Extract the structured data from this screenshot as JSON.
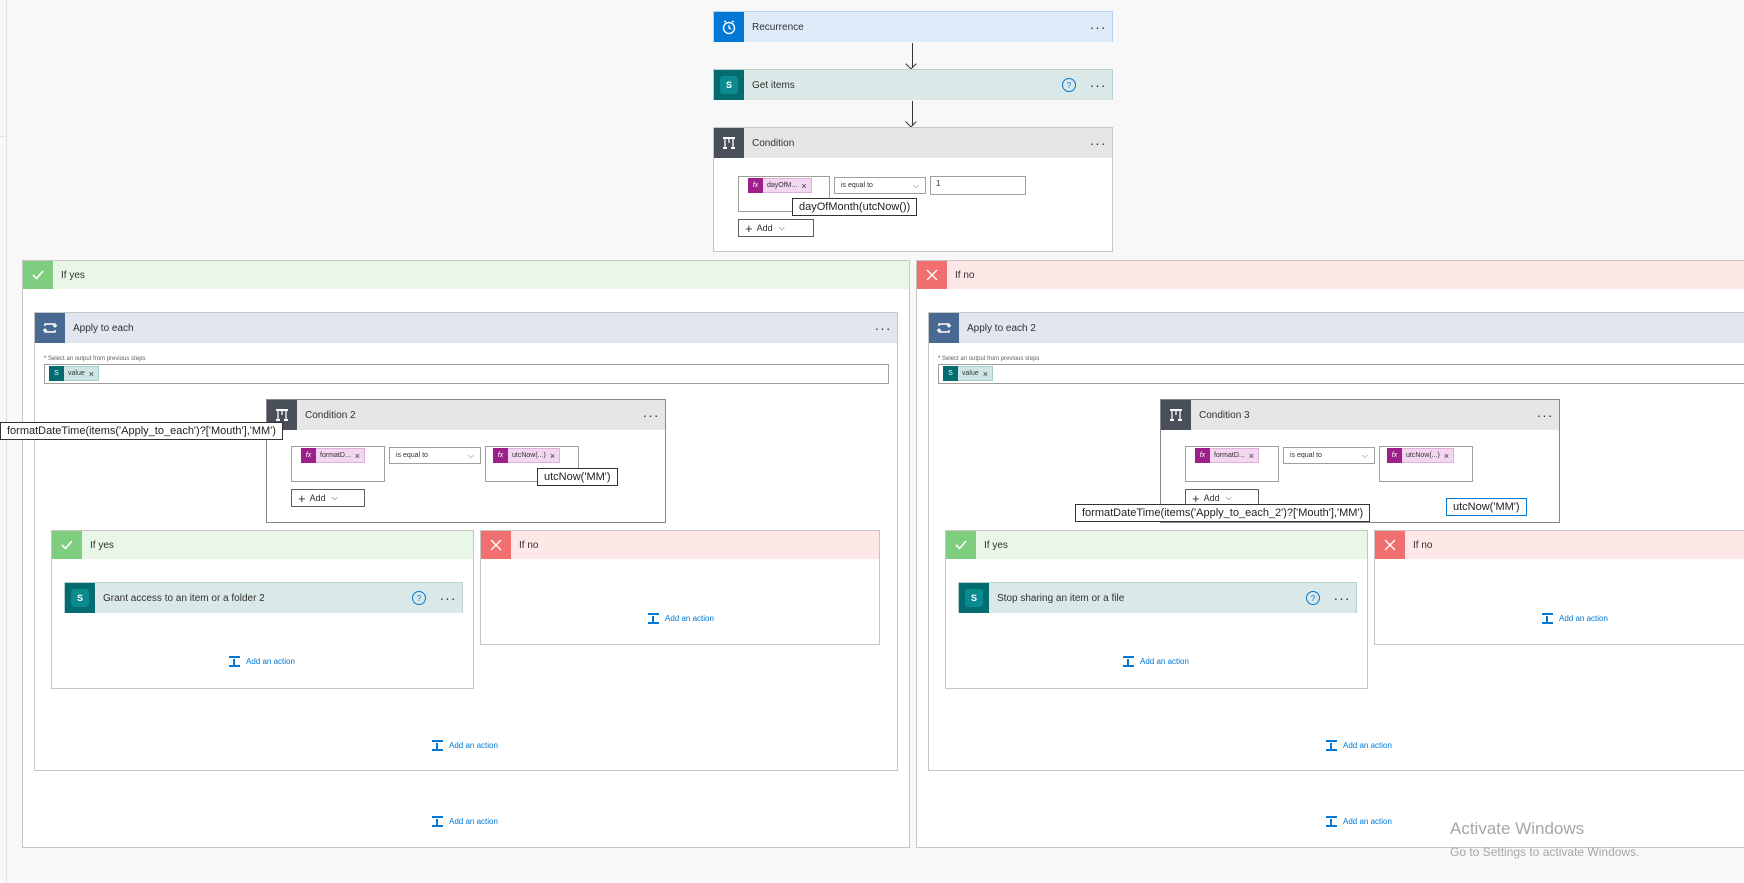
{
  "flow": {
    "recurrence": {
      "title": "Recurrence",
      "color": "#0078d4",
      "icon": "clock-icon"
    },
    "get_items": {
      "title": "Get items",
      "color": "#036c70",
      "icon": "sharepoint-icon"
    },
    "condition": {
      "title": "Condition",
      "token_text": "dayOfM...",
      "operator": "is equal to",
      "value": "1",
      "tooltip": "dayOfMonth(utcNow())",
      "add_label": "Add"
    }
  },
  "branch_yes": {
    "label": "If yes",
    "apply": {
      "title": "Apply to each",
      "select_label": "Select an output from previous steps",
      "token": "value",
      "condition": {
        "title": "Condition 2",
        "left_token": "formatD...",
        "operator": "is equal to",
        "right_token": "utcNow(...)",
        "tooltip_left": "formatDateTime(items('Apply_to_each')?['Mouth'],'MM')",
        "tooltip_right": "utcNow('MM')",
        "add_label": "Add"
      },
      "yes": {
        "label": "If yes",
        "action": "Grant access to an item or a folder 2"
      },
      "no": {
        "label": "If no"
      }
    }
  },
  "branch_no": {
    "label": "If no",
    "apply": {
      "title": "Apply to each 2",
      "select_label": "Select an output from previous steps",
      "token": "value",
      "condition": {
        "title": "Condition 3",
        "left_token": "formatD...",
        "operator": "is equal to",
        "right_token": "utcNow(...)",
        "tooltip_left": "formatDateTime(items('Apply_to_each_2')?['Mouth'],'MM')",
        "tooltip_right": "utcNow('MM')",
        "add_label": "Add"
      },
      "yes": {
        "label": "If yes",
        "action": "Stop sharing an item or a file"
      },
      "no": {
        "label": "If no"
      }
    }
  },
  "common": {
    "add_action": "Add an action",
    "required_mark": "*"
  },
  "watermark": {
    "title": "Activate Windows",
    "subtitle": "Go to Settings to activate Windows."
  }
}
